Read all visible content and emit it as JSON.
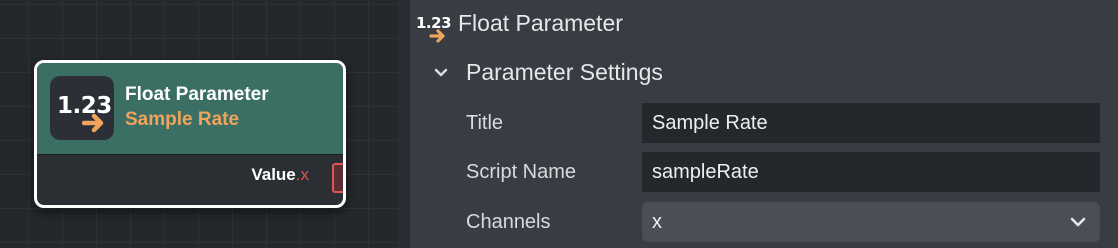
{
  "node": {
    "icon_text": "1.23",
    "icon": "float-arrow-icon",
    "title": "Float Parameter",
    "subtitle": "Sample Rate",
    "output_port": {
      "label": "Value",
      "separator": ".",
      "channel": "x"
    },
    "colors": {
      "header": "#3b6f63",
      "subtitle": "#f0a35c",
      "port": "#e05555"
    }
  },
  "inspector": {
    "header": {
      "icon_text": "1.23",
      "icon": "float-arrow-icon",
      "title": "Float Parameter"
    },
    "section": {
      "title": "Parameter Settings",
      "expanded": true
    },
    "fields": {
      "title": {
        "label": "Title",
        "value": "Sample Rate"
      },
      "script_name": {
        "label": "Script Name",
        "value": "sampleRate"
      },
      "channels": {
        "label": "Channels",
        "value": "x"
      }
    }
  }
}
